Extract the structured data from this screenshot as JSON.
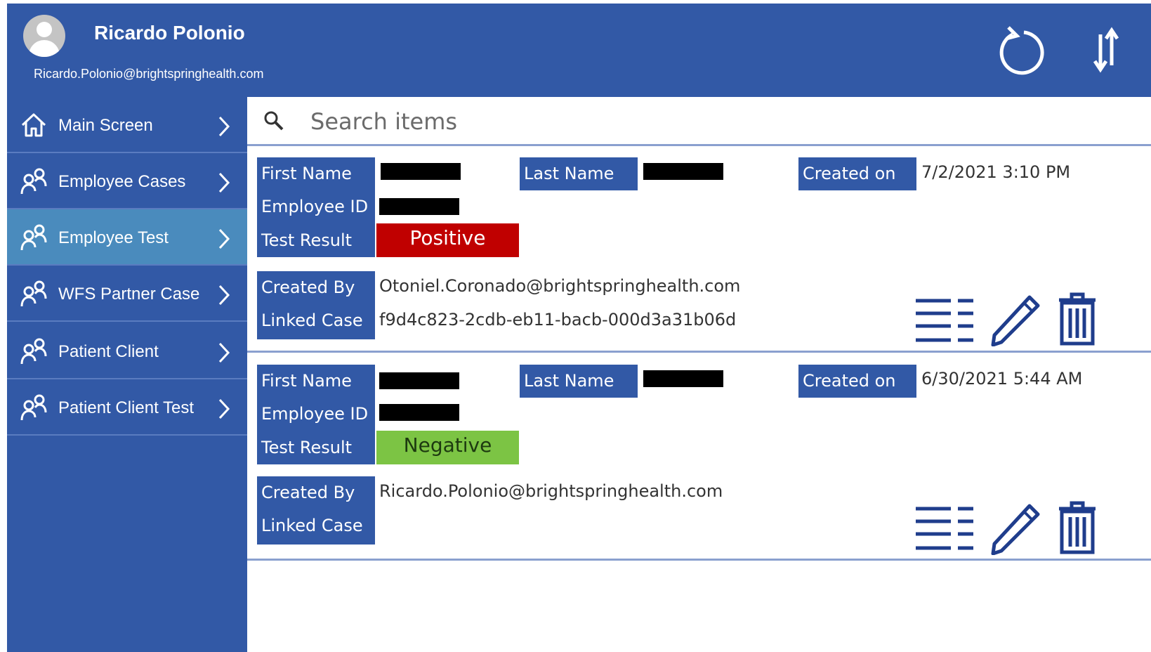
{
  "header": {
    "user_name": "Ricardo Polonio",
    "user_email": "Ricardo.Polonio@brightspringhealth.com",
    "icons": [
      "refresh-icon",
      "sort-icon"
    ]
  },
  "sidebar": {
    "items": [
      {
        "label": "Main Screen",
        "icon": "home-icon",
        "active": false
      },
      {
        "label": "Employee Cases",
        "icon": "people-icon",
        "active": false
      },
      {
        "label": "Employee Test",
        "icon": "people-icon",
        "active": true
      },
      {
        "label": "WFS Partner Case",
        "icon": "people-icon",
        "active": false
      },
      {
        "label": "Patient Client",
        "icon": "people-icon",
        "active": false
      },
      {
        "label": "Patient Client Test",
        "icon": "people-icon",
        "active": false
      }
    ]
  },
  "search": {
    "placeholder": "Search items",
    "value": ""
  },
  "labels": {
    "first_name": "First Name",
    "last_name": "Last Name",
    "created_on": "Created on",
    "employee_id": "Employee ID",
    "test_result": "Test Result",
    "created_by": "Created By",
    "linked_case": "Linked Case"
  },
  "records": [
    {
      "created_on": "7/2/2021 3:10 PM",
      "test_result": "Positive",
      "result_color": "#c00000",
      "result_text_color": "#ffffff",
      "created_by": "Otoniel.Coronado@brightspringhealth.com",
      "linked_case": "f9d4c823-2cdb-eb11-bacb-000d3a31b06d"
    },
    {
      "created_on": "6/30/2021 5:44 AM",
      "test_result": "Negative",
      "result_color": "#7cc444",
      "result_text_color": "#1d3a10",
      "created_by": "Ricardo.Polonio@brightspringhealth.com",
      "linked_case": ""
    }
  ],
  "colors": {
    "brand_blue": "#3259a6",
    "active_nav": "#4a8bbd",
    "icon_navy": "#1f3d8c"
  }
}
